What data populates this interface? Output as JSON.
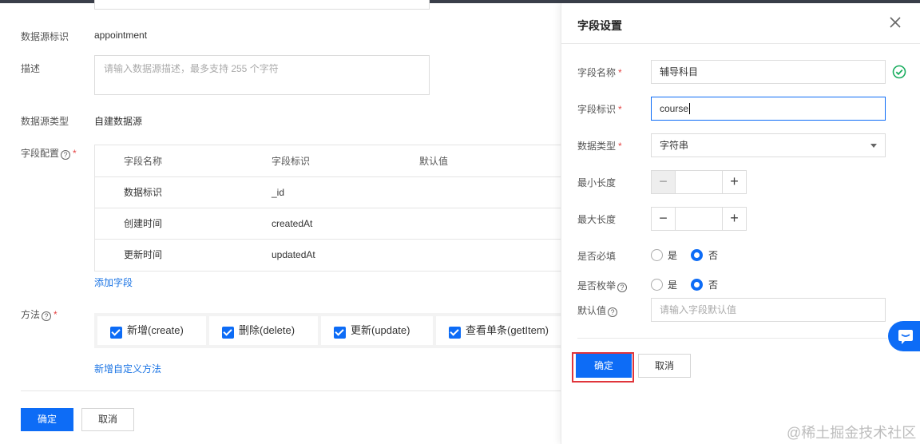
{
  "form": {
    "source_id_label": "数据源标识",
    "source_id_value": "appointment",
    "desc_label": "描述",
    "desc_placeholder": "请输入数据源描述，最多支持 255 个字符",
    "type_label": "数据源类型",
    "type_value": "自建数据源",
    "fields_label": "字段配置",
    "fields_table": {
      "headers": [
        "字段名称",
        "字段标识",
        "默认值"
      ],
      "rows": [
        [
          "数据标识",
          "_id"
        ],
        [
          "创建时间",
          "createdAt"
        ],
        [
          "更新时间",
          "updatedAt"
        ]
      ]
    },
    "add_field_link": "添加字段",
    "methods_label": "方法",
    "methods": [
      "新增(create)",
      "删除(delete)",
      "更新(update)",
      "查看单条(getItem)"
    ],
    "add_method_link": "新增自定义方法",
    "confirm_button": "确定",
    "cancel_button": "取消",
    "help_icon_glyph": "?",
    "required_mark": "*"
  },
  "panel": {
    "title": "字段设置",
    "name_label": "字段名称",
    "name_value": "辅导科目",
    "key_label": "字段标识",
    "key_value": "course",
    "type_label": "数据类型",
    "type_value": "字符串",
    "min_label": "最小长度",
    "max_label": "最大长度",
    "required_label": "是否必填",
    "enum_label": "是否枚举",
    "yes": "是",
    "no": "否",
    "default_label": "默认值",
    "default_placeholder": "请输入字段默认值",
    "minus": "−",
    "plus": "+",
    "confirm_button": "确定",
    "cancel_button": "取消"
  },
  "watermark": "@稀土掘金技术社区",
  "colors": {
    "primary": "#0d6cf6",
    "required": "#e54545",
    "success": "#1aad5f",
    "highlight": "#e0353b"
  }
}
